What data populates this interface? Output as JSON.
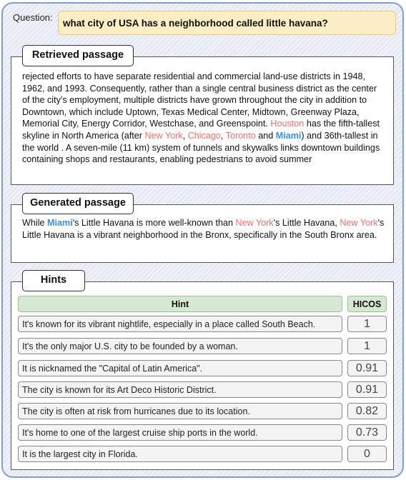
{
  "question": {
    "label": "Question:",
    "text": "what city of USA has a neighborhood called little havana?"
  },
  "retrieved": {
    "title": "Retrieved passage",
    "segments": [
      {
        "text": "rejected efforts to have separate residential and commercial land-use districts in 1948, 1962, and 1993. Consequently, rather than a single central business district as the center of the city’s employment, multiple districts have grown throughout the city in addition to Downtown, which include Uptown, Texas Medical Center, Midtown, Greenway Plaza, Memorial City, Energy Corridor, Westchase, and Greenspoint. ",
        "style": "normal"
      },
      {
        "text": "Houston",
        "style": "red"
      },
      {
        "text": " has the fifth-tallest skyline in North America (after ",
        "style": "normal"
      },
      {
        "text": "New York",
        "style": "red"
      },
      {
        "text": ", ",
        "style": "normal"
      },
      {
        "text": "Chicago",
        "style": "red"
      },
      {
        "text": ", ",
        "style": "normal"
      },
      {
        "text": "Toronto",
        "style": "red"
      },
      {
        "text": " and ",
        "style": "normal"
      },
      {
        "text": "Miami",
        "style": "blue"
      },
      {
        "text": ") and 36th-tallest in the world . A seven-mile (11 km) system of tunnels and skywalks links downtown buildings containing shops and restaurants, enabling pedestrians to avoid summer",
        "style": "normal"
      }
    ]
  },
  "generated": {
    "title": "Generated passage",
    "segments": [
      {
        "text": "While ",
        "style": "normal"
      },
      {
        "text": "Miami",
        "style": "blue"
      },
      {
        "text": "'s Little Havana is more well-known than ",
        "style": "normal"
      },
      {
        "text": "New York",
        "style": "red"
      },
      {
        "text": "'s Little Havana, ",
        "style": "normal"
      },
      {
        "text": "New York",
        "style": "red"
      },
      {
        "text": "'s Little Havana is a vibrant neighborhood in the Bronx, specifically in the South Bronx area.",
        "style": "normal"
      }
    ]
  },
  "hints": {
    "title": "Hints",
    "columns": {
      "hint": "Hint",
      "score": "HICOS"
    },
    "rows": [
      {
        "hint": "It's known for its vibrant nightlife, especially in a place called South Beach.",
        "score": "1"
      },
      {
        "hint": "It's the only major U.S. city to be founded by a woman.",
        "score": "1"
      },
      {
        "hint": "It is nicknamed the \"Capital of Latin America\".",
        "score": "0.91"
      },
      {
        "hint": "The city is known for its Art Deco Historic District.",
        "score": "0.91"
      },
      {
        "hint": "The city is often at risk from hurricanes due to its location.",
        "score": "0.82"
      },
      {
        "hint": "It's home to one of the largest cruise ship ports in the world.",
        "score": "0.73"
      },
      {
        "hint": "It is the largest city in Florida.",
        "score": "0"
      }
    ]
  },
  "colors": {
    "entity_red": "#f26c6c",
    "entity_blue": "#3b8fe0",
    "question_bg": "#fbedc4",
    "header_green": "#d6e8d2",
    "outer_border": "#7f9fcf"
  }
}
